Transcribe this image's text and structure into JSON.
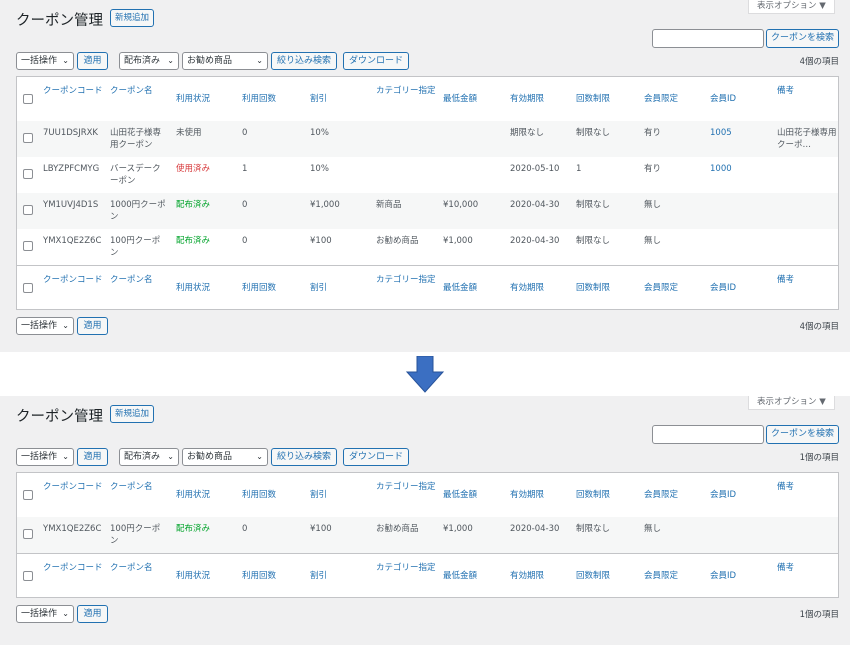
{
  "panels": [
    {
      "id": "before",
      "title": "クーポン管理",
      "add_new": "新規追加",
      "screen_options": "表示オプション ▼",
      "search_value": "",
      "search_button": "クーポンを検索",
      "bulk_action": "一括操作",
      "apply": "適用",
      "filter_status": "配布済み",
      "filter_category": "お勧め商品",
      "filter_button": "絞り込み検索",
      "download_button": "ダウンロード",
      "count_top": "4個の項目",
      "count_bottom": "4個の項目",
      "columns": [
        "クーポンコード",
        "クーポン名",
        "利用状況",
        "利用回数",
        "割引",
        "カテゴリー指定",
        "最低金額",
        "有効期限",
        "回数制限",
        "会員限定",
        "会員ID",
        "備考"
      ],
      "rows": [
        {
          "code": "7UU1DSJRXK",
          "name": "山田花子様専用クーポン",
          "status": "未使用",
          "status_type": "unused",
          "uses": "0",
          "discount": "10%",
          "category": "",
          "min": "",
          "expiry": "期限なし",
          "limit": "制限なし",
          "member_only": "有り",
          "member_id": "1005",
          "note": "山田花子様専用クーポ…"
        },
        {
          "code": "LBYZPFCMYG",
          "name": "バースデークーポン",
          "status": "使用済み",
          "status_type": "used",
          "uses": "1",
          "discount": "10%",
          "category": "",
          "min": "",
          "expiry": "2020-05-10",
          "limit": "1",
          "member_only": "有り",
          "member_id": "1000",
          "note": ""
        },
        {
          "code": "YM1UVJ4D1S",
          "name": "1000円クーポン",
          "status": "配布済み",
          "status_type": "distributed",
          "uses": "0",
          "discount": "¥1,000",
          "category": "新商品",
          "min": "¥10,000",
          "expiry": "2020-04-30",
          "limit": "制限なし",
          "member_only": "無し",
          "member_id": "",
          "note": ""
        },
        {
          "code": "YMX1QE2Z6C",
          "name": "100円クーポン",
          "status": "配布済み",
          "status_type": "distributed",
          "uses": "0",
          "discount": "¥100",
          "category": "お勧め商品",
          "min": "¥1,000",
          "expiry": "2020-04-30",
          "limit": "制限なし",
          "member_only": "無し",
          "member_id": "",
          "note": ""
        }
      ]
    },
    {
      "id": "after",
      "title": "クーポン管理",
      "add_new": "新規追加",
      "screen_options": "表示オプション ▼",
      "search_value": "",
      "search_button": "クーポンを検索",
      "bulk_action": "一括操作",
      "apply": "適用",
      "filter_status": "配布済み",
      "filter_category": "お勧め商品",
      "filter_button": "絞り込み検索",
      "download_button": "ダウンロード",
      "count_top": "1個の項目",
      "count_bottom": "1個の項目",
      "columns": [
        "クーポンコード",
        "クーポン名",
        "利用状況",
        "利用回数",
        "割引",
        "カテゴリー指定",
        "最低金額",
        "有効期限",
        "回数制限",
        "会員限定",
        "会員ID",
        "備考"
      ],
      "rows": [
        {
          "code": "YMX1QE2Z6C",
          "name": "100円クーポン",
          "status": "配布済み",
          "status_type": "distributed",
          "uses": "0",
          "discount": "¥100",
          "category": "お勧め商品",
          "min": "¥1,000",
          "expiry": "2020-04-30",
          "limit": "制限なし",
          "member_only": "無し",
          "member_id": "",
          "note": ""
        }
      ]
    }
  ],
  "colors": {
    "accent": "#2271b1",
    "used": "#d63638",
    "distributed": "#00a32a",
    "arrow": "#3b6fc2"
  },
  "icons": {
    "arrow": "arrow-down-icon",
    "caret": "chevron-down-icon"
  }
}
